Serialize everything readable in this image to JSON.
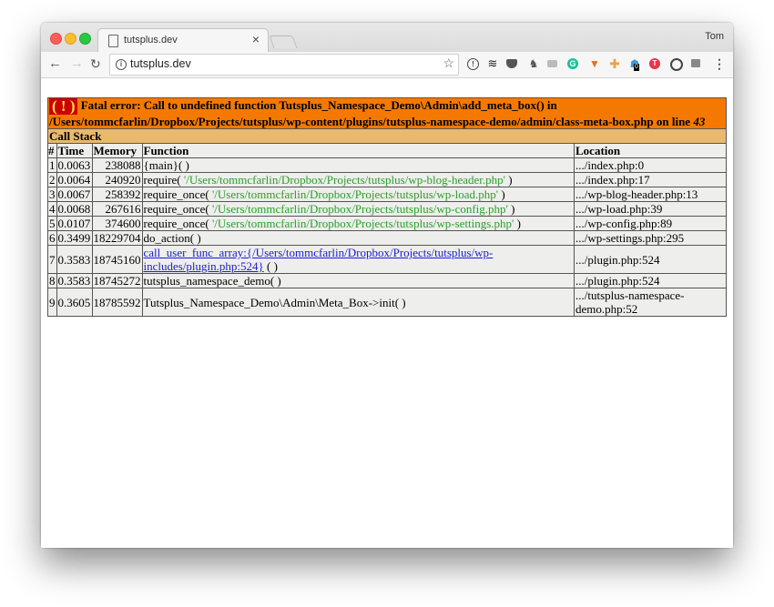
{
  "browser": {
    "tab_title": "tutsplus.dev",
    "profile_name": "Tom",
    "url": "tutsplus.dev",
    "extensions": [
      "1password-icon",
      "buffer-icon",
      "pocket-icon",
      "evernote-icon",
      "screenshot-icon",
      "grammarly-icon",
      "fox-extension-icon",
      "clock-extension-icon",
      "ghostery-icon",
      "tumblr-extension-icon",
      "vpn-icon",
      "tabs-icon",
      "menu-icon"
    ],
    "ghostery_badge": "0"
  },
  "error": {
    "badge": "( ! )",
    "message_prefix": "Fatal error: Call to undefined function Tutsplus_Namespace_Demo\\Admin\\add_meta_box() in /Users/tommcfarlin/Dropbox/Projects/tutsplus/wp-content/plugins/tutsplus-namespace-demo/admin/class-meta-box.php on line ",
    "line": "43",
    "call_stack_title": "Call Stack",
    "headers": [
      "#",
      "Time",
      "Memory",
      "Function",
      "Location"
    ],
    "colors": {
      "error_bg": "#f57900",
      "callstack_bg": "#e9b96e",
      "row_bg": "#eeeeec",
      "string_color": "#2aa02a",
      "link_color": "#1b1bd8"
    }
  },
  "rows": [
    {
      "n": "1",
      "time": "0.0063",
      "memory": "238088",
      "func": "{main}( )",
      "arg": "",
      "close": "",
      "location": ".../index.php:0"
    },
    {
      "n": "2",
      "time": "0.0064",
      "memory": "240920",
      "func": "require( ",
      "arg": "'/Users/tommcfarlin/Dropbox/Projects/tutsplus/wp-blog-header.php'",
      "close": " )",
      "location": ".../index.php:17"
    },
    {
      "n": "3",
      "time": "0.0067",
      "memory": "258392",
      "func": "require_once( ",
      "arg": "'/Users/tommcfarlin/Dropbox/Projects/tutsplus/wp-load.php'",
      "close": " )",
      "location": ".../wp-blog-header.php:13"
    },
    {
      "n": "4",
      "time": "0.0068",
      "memory": "267616",
      "func": "require_once( ",
      "arg": "'/Users/tommcfarlin/Dropbox/Projects/tutsplus/wp-config.php'",
      "close": " )",
      "location": ".../wp-load.php:39"
    },
    {
      "n": "5",
      "time": "0.0107",
      "memory": "374600",
      "func": "require_once( ",
      "arg": "'/Users/tommcfarlin/Dropbox/Projects/tutsplus/wp-settings.php'",
      "close": " )",
      "location": ".../wp-config.php:89"
    },
    {
      "n": "6",
      "time": "0.3499",
      "memory": "18229704",
      "func": "do_action( )",
      "arg": "",
      "close": "",
      "location": ".../wp-settings.php:295"
    },
    {
      "n": "7",
      "time": "0.3583",
      "memory": "18745160",
      "link": "call_user_func_array:{/Users/tommcfarlin/Dropbox/Projects/tutsplus/wp-includes/plugin.php:524}",
      "close": " ( )",
      "location": ".../plugin.php:524"
    },
    {
      "n": "8",
      "time": "0.3583",
      "memory": "18745272",
      "func": "tutsplus_namespace_demo( )",
      "arg": "",
      "close": "",
      "location": ".../plugin.php:524"
    },
    {
      "n": "9",
      "time": "0.3605",
      "memory": "18785592",
      "func": "Tutsplus_Namespace_Demo\\Admin\\Meta_Box->init( )",
      "arg": "",
      "close": "",
      "location": ".../tutsplus-namespace-demo.php:52"
    }
  ]
}
